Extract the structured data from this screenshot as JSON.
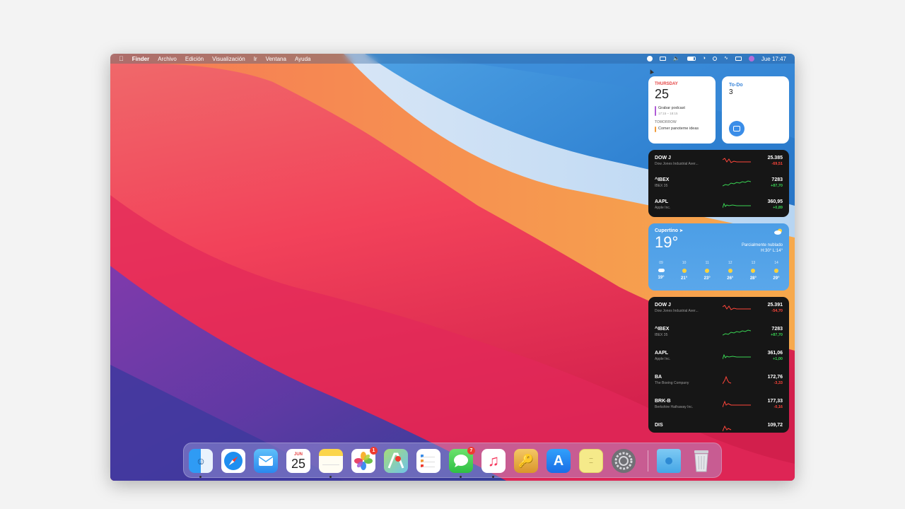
{
  "menubar": {
    "apple_icon": "apple-icon",
    "app_name": "Finder",
    "menus": [
      "Archivo",
      "Edición",
      "Visualización",
      "Ir",
      "Ventana",
      "Ayuda"
    ],
    "clock": "Jue 17:47"
  },
  "calendar_widget": {
    "day_label": "THURSDAY",
    "date": "25",
    "event1_title": "Grabar podcast",
    "event1_time": "17:15 – 18:15",
    "section_label": "TOMORROW",
    "event2_title": "Comer panoteme ideas"
  },
  "todo_widget": {
    "title": "To-Do",
    "count": "3"
  },
  "stocks1": [
    {
      "symbol": "DOW J",
      "name": "Dow Jones Industrial Aver...",
      "price": "25.385",
      "change": "-69,51",
      "trend": "down"
    },
    {
      "symbol": "^IBEX",
      "name": "IBEX 35",
      "price": "7283",
      "change": "+87,70",
      "trend": "up"
    },
    {
      "symbol": "AAPL",
      "name": "Apple Inc.",
      "price": "360,95",
      "change": "+0,89",
      "trend": "up"
    }
  ],
  "weather": {
    "city": "Cupertino",
    "temp": "19°",
    "condition": "Parcialmente nublado",
    "hilo": "H:30° L:14°",
    "hours": [
      {
        "h": "09",
        "t": "19°",
        "icon": "cloud"
      },
      {
        "h": "10",
        "t": "21°",
        "icon": "sun"
      },
      {
        "h": "11",
        "t": "23°",
        "icon": "sun"
      },
      {
        "h": "12",
        "t": "26°",
        "icon": "sun"
      },
      {
        "h": "13",
        "t": "28°",
        "icon": "sun"
      },
      {
        "h": "14",
        "t": "29°",
        "icon": "sun"
      }
    ]
  },
  "stocks2": [
    {
      "symbol": "DOW J",
      "name": "Dow Jones Industrial Aver...",
      "price": "25.391",
      "change": "-54,70",
      "trend": "down"
    },
    {
      "symbol": "^IBEX",
      "name": "IBEX 35",
      "price": "7283",
      "change": "+87,70",
      "trend": "up"
    },
    {
      "symbol": "AAPL",
      "name": "Apple Inc.",
      "price": "361,06",
      "change": "+1,00",
      "trend": "up"
    },
    {
      "symbol": "BA",
      "name": "The Boeing Company",
      "price": "172,76",
      "change": "-3,33",
      "trend": "down"
    },
    {
      "symbol": "BRK-B",
      "name": "Berkshire Hathaway Inc.",
      "price": "177,33",
      "change": "-0,16",
      "trend": "down"
    },
    {
      "symbol": "DIS",
      "name": "",
      "price": "109,72",
      "change": "",
      "trend": "down"
    }
  ],
  "dock": {
    "apps": [
      {
        "name": "finder",
        "icon": "finder-icon",
        "color": "#2f9bf4",
        "running": true
      },
      {
        "name": "safari",
        "icon": "safari-icon",
        "color": "#1f8ff0",
        "running": false
      },
      {
        "name": "mail",
        "icon": "mail-icon",
        "color": "#3ea6f4",
        "running": false
      },
      {
        "name": "calendar",
        "icon": "calendar-icon",
        "month": "JUN",
        "day": "25",
        "running": false
      },
      {
        "name": "notes",
        "icon": "notes-icon",
        "color": "#fbe27a",
        "running": true
      },
      {
        "name": "photos",
        "icon": "photos-icon",
        "color": "#ffffff",
        "badge": "1",
        "running": false
      },
      {
        "name": "maps",
        "icon": "maps-icon",
        "color": "#8ed16a",
        "running": false
      },
      {
        "name": "reminders",
        "icon": "reminders-icon",
        "color": "#ffffff",
        "running": false
      },
      {
        "name": "messages",
        "icon": "messages-icon",
        "color": "#3ccf55",
        "badge": "7",
        "running": true
      },
      {
        "name": "music",
        "icon": "music-icon",
        "color": "#ffffff",
        "running": true
      },
      {
        "name": "keychain",
        "icon": "keychain-icon",
        "color": "#f0b84a",
        "running": false
      },
      {
        "name": "app-store",
        "icon": "app-store-icon",
        "color": "#2d8df2",
        "running": false
      },
      {
        "name": "stickies",
        "icon": "stickies-icon",
        "color": "#f5ea8a",
        "running": false
      },
      {
        "name": "system-preferences",
        "icon": "gear-icon",
        "color": "#8b8b8f",
        "running": false
      },
      {
        "name": "downloads",
        "icon": "downloads-folder-icon",
        "color": "#5cb4ee",
        "running": false
      },
      {
        "name": "trash",
        "icon": "trash-icon",
        "color": "#d8d8dc",
        "running": false
      }
    ]
  },
  "colors": {
    "up": "#39d353",
    "down": "#ff453a",
    "calendar_red": "#e54545",
    "todo_blue": "#3b86d9"
  }
}
